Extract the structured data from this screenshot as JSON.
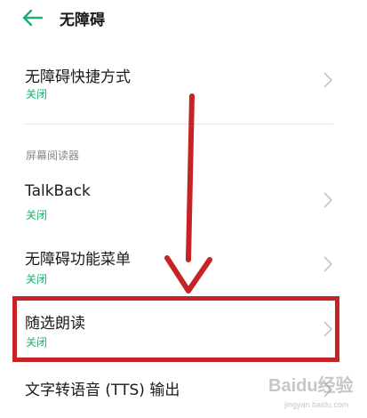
{
  "header": {
    "title": "无障碍",
    "back_icon": "arrow-left-icon"
  },
  "rows": [
    {
      "title": "无障碍快捷方式",
      "status": "关闭"
    },
    {
      "title": "TalkBack",
      "status": "关闭"
    },
    {
      "title": "无障碍功能菜单",
      "status": "关闭"
    },
    {
      "title": "随选朗读",
      "status": "关闭"
    },
    {
      "title": "文字转语音 (TTS) 输出"
    }
  ],
  "section": {
    "label": "屏幕阅读器"
  },
  "watermark": {
    "text": "Baidu经验",
    "sub": "jingyan.baidu.com"
  },
  "colors": {
    "accent": "#1fae6f",
    "highlight": "#c62424"
  }
}
